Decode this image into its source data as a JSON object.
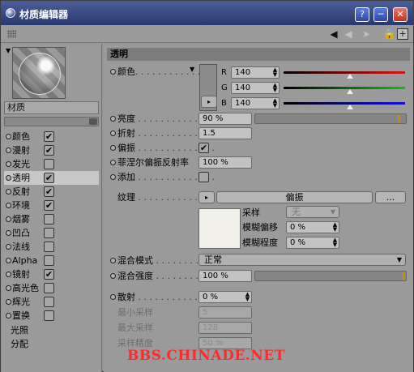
{
  "window": {
    "title": "材质编辑器",
    "buttons": {
      "help": "?",
      "minimize": "─",
      "maximize": "□",
      "close": "✕"
    }
  },
  "toolbar": {
    "icons": [
      "grip-icon",
      "arrow-left-icon",
      "arrow-left-dim-icon",
      "pointer-dim-icon",
      "lock-icon",
      "new-window-icon"
    ]
  },
  "left_panel": {
    "material_name": "材质",
    "channels": [
      {
        "label": "颜色",
        "checked": true
      },
      {
        "label": "漫射",
        "checked": true
      },
      {
        "label": "发光",
        "checked": false
      },
      {
        "label": "透明",
        "checked": true,
        "selected": true
      },
      {
        "label": "反射",
        "checked": true
      },
      {
        "label": "环境",
        "checked": true
      },
      {
        "label": "烟雾",
        "checked": false
      },
      {
        "label": "凹凸",
        "checked": false
      },
      {
        "label": "法线",
        "checked": false
      },
      {
        "label": "Alpha",
        "checked": false
      },
      {
        "label": "镜射",
        "checked": true
      },
      {
        "label": "高光色",
        "checked": false
      },
      {
        "label": "辉光",
        "checked": false
      },
      {
        "label": "置换",
        "checked": false
      }
    ],
    "extra": [
      "光照",
      "分配"
    ]
  },
  "panel": {
    "section_title": "透明",
    "color_label": "颜色",
    "dots": ". . . . . . . . . . . . .",
    "rgb": [
      {
        "channel": "R",
        "value": "140",
        "color": "#e01010"
      },
      {
        "channel": "G",
        "value": "140",
        "color": "#10c010"
      },
      {
        "channel": "B",
        "value": "140",
        "color": "#1010e0"
      }
    ],
    "brightness": {
      "label": "亮度",
      "value": "90 %"
    },
    "refraction": {
      "label": "折射",
      "value": "1.5"
    },
    "polarize": {
      "label": "偏振",
      "checked": true
    },
    "fresnel": {
      "label": "菲涅尔偏振反射率",
      "value": "100 %"
    },
    "additive": {
      "label": "添加",
      "checked": false
    },
    "texture": {
      "label": "纹理",
      "button": "偏振",
      "more": "...",
      "sampling_label": "采样",
      "sampling_value": "无",
      "blur_offset_label": "模糊偏移",
      "blur_offset_value": "0 %",
      "blur_scale_label": "模糊程度",
      "blur_scale_value": "0 %"
    },
    "mix_mode": {
      "label": "混合模式",
      "value": "正常"
    },
    "mix_strength": {
      "label": "混合强度",
      "value": "100 %"
    },
    "dispersion": {
      "label": "散射",
      "value": "0 %"
    },
    "min_samples": {
      "label": "最小采样",
      "value": "5"
    },
    "max_samples": {
      "label": "最大采样",
      "value": "128"
    },
    "accuracy": {
      "label": "采样精度",
      "value": "50 %"
    }
  },
  "watermark": "BBS.CHINADE.NET"
}
